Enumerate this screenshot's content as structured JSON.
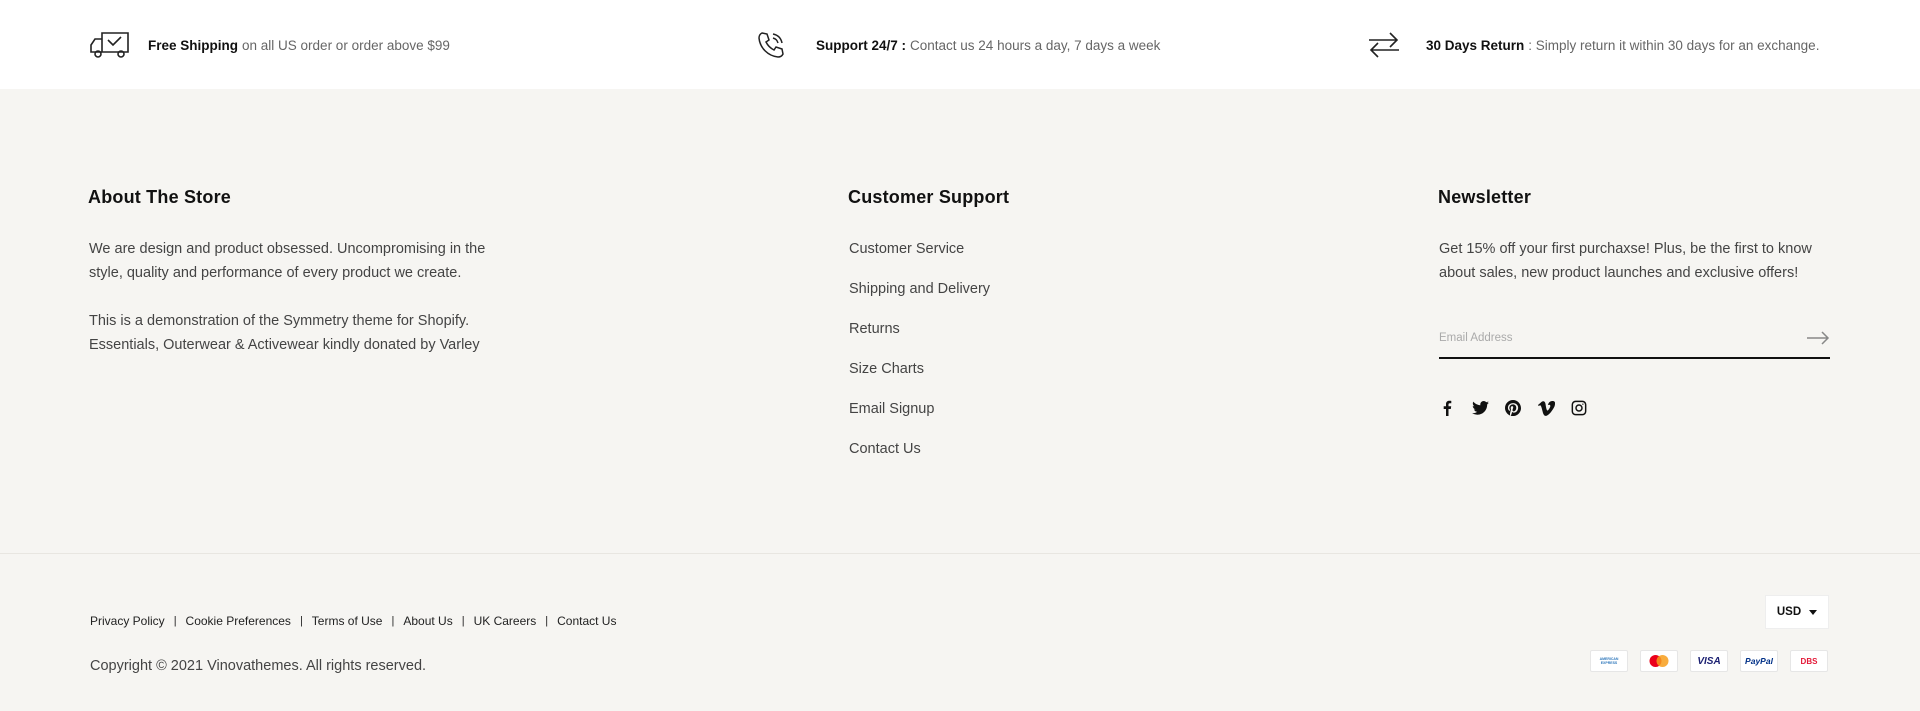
{
  "features": [
    {
      "icon": "delivery-truck-icon",
      "title": "Free Shipping",
      "text": "on all US order or order above $99"
    },
    {
      "icon": "phone-icon",
      "title": "Support 24/7 :",
      "text": "Contact us 24 hours a day, 7 days a week"
    },
    {
      "icon": "exchange-arrows-icon",
      "title": "30 Days Return",
      "text": ": Simply return it within 30 days for an exchange."
    }
  ],
  "about": {
    "title": "About The Store",
    "paragraph1": "We are design and product obsessed. Uncompromising in the style, quality and performance of every product we create.",
    "paragraph2": "This is a demonstration of the Symmetry theme for Shopify. Essentials, Outerwear & Activewear kindly donated by Varley"
  },
  "support": {
    "title": "Customer Support",
    "links": [
      "Customer Service",
      "Shipping and Delivery",
      "Returns",
      "Size Charts",
      "Email Signup",
      "Contact Us"
    ]
  },
  "newsletter": {
    "title": "Newsletter",
    "text": "Get 15% off your first purchaxse! Plus, be the first to know about sales, new product launches and exclusive offers!",
    "email_placeholder": "Email Address",
    "email_value": "",
    "socials": [
      "facebook-icon",
      "twitter-icon",
      "pinterest-icon",
      "vimeo-icon",
      "instagram-icon"
    ]
  },
  "legal_links": [
    "Privacy Policy",
    "Cookie Preferences",
    "Terms of Use",
    "About Us",
    "UK Careers",
    "Contact Us"
  ],
  "copyright": "Copyright © 2021 Vinovathemes. All rights reserved.",
  "currency": "USD",
  "payments": [
    {
      "icon": "american-express-icon",
      "label": "AMERICAN EXPRESS",
      "color": "#2e77bb"
    },
    {
      "icon": "mastercard-icon",
      "label": "",
      "color": "#eb001b"
    },
    {
      "icon": "visa-icon",
      "label": "VISA",
      "color": "#1a1f71"
    },
    {
      "icon": "paypal-icon",
      "label": "PayPal",
      "color": "#003087"
    },
    {
      "icon": "dbs-icon",
      "label": "DBS",
      "color": "#e31837"
    }
  ]
}
